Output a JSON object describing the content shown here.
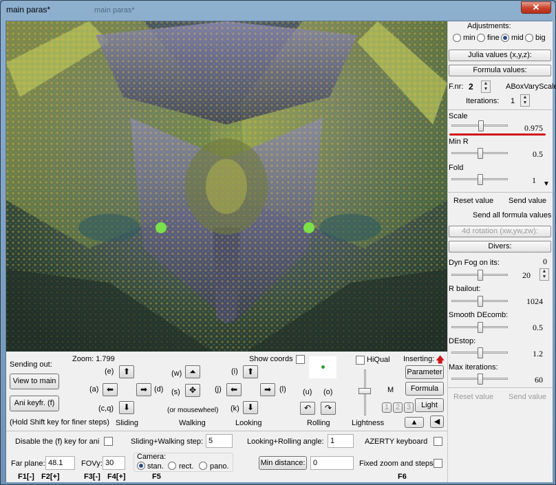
{
  "window": {
    "title": "main paras*",
    "close": "✕",
    "ghost_title": "main paras*"
  },
  "side": {
    "adjustments": {
      "label": "Adjustments:",
      "options": [
        "min",
        "fine",
        "mid",
        "big"
      ],
      "selected": "mid"
    },
    "julia_btn": "Julia values (x,y,z):",
    "formula_btn": "Formula values:",
    "fnr_label": "F.nr:",
    "fnr_value": "2",
    "formula_name": "ABoxVaryScale",
    "iterations_label": "Iterations:",
    "iterations_value": "1",
    "params": [
      {
        "label": "Scale",
        "value": "0.975",
        "level": 0.35
      },
      {
        "label": "Min R",
        "value": "0.5",
        "level": 0.5
      },
      {
        "label": "Fold",
        "value": "1",
        "level": 0.5
      }
    ],
    "reset_value": "Reset value",
    "send_value": "Send value",
    "send_all": "Send all formula values",
    "rotation_btn": "4d rotation (xw,yw,zw):",
    "divers_btn": "Divers:",
    "divers": [
      {
        "label": "Dyn Fog on its:",
        "value": "20",
        "extra": "0",
        "level": 0.5
      },
      {
        "label": "R bailout:",
        "value": "1024",
        "level": 0.5
      },
      {
        "label": "Smooth DEcomb:",
        "value": "0.5",
        "level": 0.5
      },
      {
        "label": "DEstop:",
        "value": "1.2",
        "level": 0.5
      },
      {
        "label": "Max iterations:",
        "value": "60",
        "level": 0.5
      }
    ],
    "reset_value2": "Reset value",
    "send_value2": "Send value"
  },
  "controls": {
    "sending_out": "Sending out:",
    "view_to_main": "View to main",
    "ani_keyfr": "Ani keyfr. (f)",
    "hold_shift": "(Hold Shift key for finer steps)",
    "zoom": "Zoom: 1.799",
    "show_coords": "Show coords",
    "hiqual": "HiQual",
    "inserting": "Inserting:",
    "parameter_btn": "Parameter",
    "formula_btn": "Formula",
    "light_btn": "Light",
    "m_label": "M",
    "num_btns": [
      "1",
      "2",
      "3"
    ],
    "keys": {
      "e": "(e)",
      "a": "(a)",
      "d": "(d)",
      "cq": "(c,q)",
      "w": "(w)",
      "s": "(s)",
      "i": "(i)",
      "j": "(j)",
      "l": "(l)",
      "k": "(k)",
      "u": "(u)",
      "o": "(o)"
    },
    "mousewheel": "(or mousewheel)",
    "groups": [
      "Sliding",
      "Walking",
      "Looking",
      "Rolling",
      "Lightness"
    ],
    "disable_f": "Disable the (f) key for ani",
    "sliding_step_label": "Sliding+Walking step:",
    "sliding_step": "5",
    "looking_angle_label": "Looking+Rolling angle:",
    "looking_angle": "1",
    "azerty": "AZERTY keyboard",
    "far_plane_label": "Far plane:",
    "far_plane": "48.1",
    "fovy_label": "FOVy:",
    "fovy": "30",
    "camera_label": "Camera:",
    "camera_options": [
      "stan.",
      "rect.",
      "pano."
    ],
    "camera_selected": "stan.",
    "min_distance_btn": "Min distance:",
    "min_distance": "0",
    "fixed_zoom": "Fixed zoom and steps",
    "fkeys": {
      "f1": "F1[-]",
      "f2": "F2[+]",
      "f3": "F3[-]",
      "f4": "F4[+]",
      "f5": "F5",
      "f6": "F6"
    }
  },
  "colors": {
    "accent": "#d0141b",
    "arrow": "#000000",
    "status": "#2aa02a"
  }
}
